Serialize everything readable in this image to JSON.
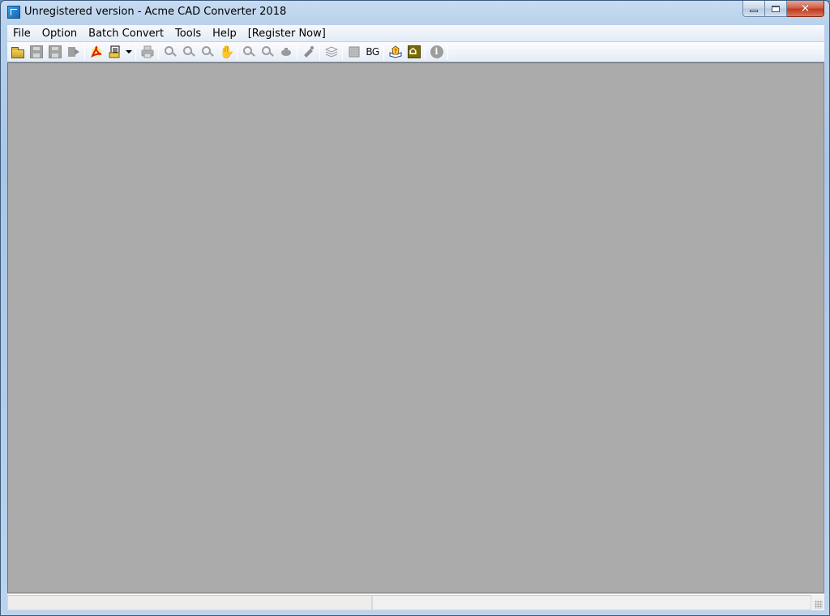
{
  "window": {
    "title": "Unregistered version - Acme CAD Converter 2018",
    "close_glyph": "✕"
  },
  "menu": [
    {
      "label": "File"
    },
    {
      "label": "Option"
    },
    {
      "label": "Batch Convert"
    },
    {
      "label": "Tools"
    },
    {
      "label": "Help"
    },
    {
      "label": "[Register Now]"
    }
  ],
  "toolbar": {
    "buttons": [
      {
        "name": "open-file",
        "icon": "folder-open-icon",
        "enabled": true
      },
      {
        "name": "save",
        "icon": "save-icon",
        "enabled": false
      },
      {
        "name": "save-as",
        "icon": "save-as-icon",
        "enabled": false
      },
      {
        "name": "export",
        "icon": "export-icon",
        "enabled": false
      },
      {
        "name": "convert-to-pdf",
        "icon": "pdf-icon",
        "enabled": true
      },
      {
        "name": "batch-convert",
        "icon": "batch-convert-icon",
        "enabled": true,
        "has_dropdown": true
      },
      {
        "name": "print",
        "icon": "printer-icon",
        "enabled": false
      },
      {
        "name": "zoom-out",
        "icon": "zoom-out-icon",
        "enabled": false
      },
      {
        "name": "zoom-in",
        "icon": "zoom-in-icon",
        "enabled": false
      },
      {
        "name": "zoom-window",
        "icon": "zoom-window-icon",
        "enabled": false
      },
      {
        "name": "pan",
        "icon": "pan-hand-icon",
        "enabled": false
      },
      {
        "name": "zoom-extents",
        "icon": "zoom-extents-icon",
        "enabled": false
      },
      {
        "name": "zoom-realtime",
        "icon": "zoom-realtime-icon",
        "enabled": false
      },
      {
        "name": "view-3d",
        "icon": "view-3d-icon",
        "enabled": false
      },
      {
        "name": "measure",
        "icon": "measure-icon",
        "enabled": false
      },
      {
        "name": "layers",
        "icon": "layers-icon",
        "enabled": false
      },
      {
        "name": "background-grid",
        "icon": "grid-icon",
        "enabled": false
      },
      {
        "name": "background-color",
        "label": "BG",
        "enabled": true
      },
      {
        "name": "help",
        "icon": "help-book-icon",
        "enabled": true
      },
      {
        "name": "home",
        "icon": "home-icon",
        "enabled": true
      },
      {
        "name": "about",
        "icon": "info-icon",
        "enabled": false
      }
    ]
  },
  "statusbar": {
    "pane1": "",
    "pane2": ""
  },
  "colors": {
    "canvas_bg": "#ababab",
    "pdf_red": "#d81e06",
    "home_olive": "#7a6a00"
  }
}
